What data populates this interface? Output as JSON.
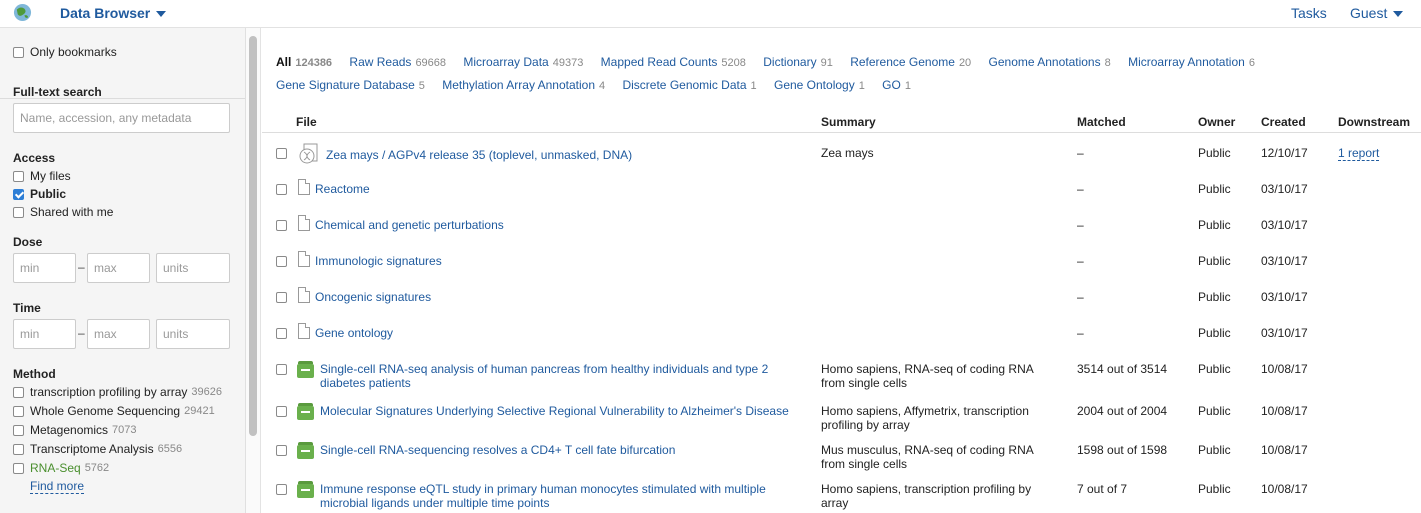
{
  "header": {
    "brand": "Data Browser",
    "tasks": "Tasks",
    "guest": "Guest"
  },
  "sidebar": {
    "only_bookmarks": "Only bookmarks",
    "fulltext_title": "Full-text search",
    "fulltext_placeholder": "Name, accession, any metadata",
    "access_title": "Access",
    "access": [
      {
        "label": "My files",
        "checked": false
      },
      {
        "label": "Public",
        "checked": true
      },
      {
        "label": "Shared with me",
        "checked": false
      }
    ],
    "dose_title": "Dose",
    "time_title": "Time",
    "range_placeholders": {
      "min": "min",
      "max": "max",
      "units": "units"
    },
    "method_title": "Method",
    "methods": [
      {
        "label": "transcription profiling by array",
        "count": "39626"
      },
      {
        "label": "Whole Genome Sequencing",
        "count": "29421"
      },
      {
        "label": "Metagenomics",
        "count": "7073"
      },
      {
        "label": "Transcriptome Analysis",
        "count": "6556"
      },
      {
        "label": "RNA-Seq",
        "count": "5762"
      }
    ],
    "find_more": "Find more"
  },
  "filters": {
    "line1": [
      {
        "label": "All",
        "count": "124386"
      },
      {
        "label": "Raw Reads",
        "count": "69668"
      },
      {
        "label": "Microarray Data",
        "count": "49373"
      },
      {
        "label": "Mapped Read Counts",
        "count": "5208"
      },
      {
        "label": "Dictionary",
        "count": "91"
      },
      {
        "label": "Reference Genome",
        "count": "20"
      },
      {
        "label": "Genome Annotations",
        "count": "8"
      },
      {
        "label": "Microarray Annotation",
        "count": "6"
      }
    ],
    "line2": [
      {
        "label": "Gene Signature Database",
        "count": "5"
      },
      {
        "label": "Methylation Array Annotation",
        "count": "4"
      },
      {
        "label": "Discrete Genomic Data",
        "count": "1"
      },
      {
        "label": "Gene Ontology",
        "count": "1"
      },
      {
        "label": "GO",
        "count": "1"
      }
    ]
  },
  "table": {
    "columns": {
      "file": "File",
      "summary": "Summary",
      "matched": "Matched",
      "owner": "Owner",
      "created": "Created",
      "downstream": "Downstream"
    },
    "rows": [
      {
        "icon": "genome",
        "file": "Zea mays / AGPv4 release 35 (toplevel, unmasked, DNA)",
        "file2": "",
        "summary": "Zea mays",
        "summary2": "",
        "matched": "–",
        "owner": "Public",
        "created": "12/10/17",
        "downstream": "1 report"
      },
      {
        "icon": "file",
        "file": "Reactome",
        "file2": "",
        "summary": "",
        "summary2": "",
        "matched": "–",
        "owner": "Public",
        "created": "03/10/17",
        "downstream": ""
      },
      {
        "icon": "file",
        "file": "Chemical and genetic perturbations",
        "file2": "",
        "summary": "",
        "summary2": "",
        "matched": "–",
        "owner": "Public",
        "created": "03/10/17",
        "downstream": ""
      },
      {
        "icon": "file",
        "file": "Immunologic signatures",
        "file2": "",
        "summary": "",
        "summary2": "",
        "matched": "–",
        "owner": "Public",
        "created": "03/10/17",
        "downstream": ""
      },
      {
        "icon": "file",
        "file": "Oncogenic signatures",
        "file2": "",
        "summary": "",
        "summary2": "",
        "matched": "–",
        "owner": "Public",
        "created": "03/10/17",
        "downstream": ""
      },
      {
        "icon": "file",
        "file": "Gene ontology",
        "file2": "",
        "summary": "",
        "summary2": "",
        "matched": "–",
        "owner": "Public",
        "created": "03/10/17",
        "downstream": ""
      },
      {
        "icon": "dataset",
        "file": "Single-cell RNA-seq analysis of human pancreas from healthy individuals and type 2",
        "file2": "diabetes patients",
        "summary": "Homo sapiens, RNA-seq of coding RNA",
        "summary2": "from single cells",
        "matched": "3514 out of 3514",
        "owner": "Public",
        "created": "10/08/17",
        "downstream": ""
      },
      {
        "icon": "dataset",
        "file": "Molecular Signatures Underlying Selective Regional Vulnerability to Alzheimer's Disease",
        "file2": "",
        "summary": "Homo sapiens, Affymetrix, transcription",
        "summary2": "profiling by array",
        "matched": "2004 out of 2004",
        "owner": "Public",
        "created": "10/08/17",
        "downstream": ""
      },
      {
        "icon": "dataset",
        "file": "Single-cell RNA-sequencing resolves a CD4+ T cell fate bifurcation",
        "file2": "",
        "summary": "Mus musculus, RNA-seq of coding RNA",
        "summary2": "from single cells",
        "matched": "1598 out of 1598",
        "owner": "Public",
        "created": "10/08/17",
        "downstream": ""
      },
      {
        "icon": "dataset",
        "file": "Immune response eQTL study in primary human monocytes stimulated with multiple",
        "file2": "microbial ligands under multiple time points",
        "summary": "Homo sapiens, transcription profiling by",
        "summary2": "array",
        "matched": "7 out of 7",
        "owner": "Public",
        "created": "10/08/17",
        "downstream": ""
      }
    ]
  }
}
